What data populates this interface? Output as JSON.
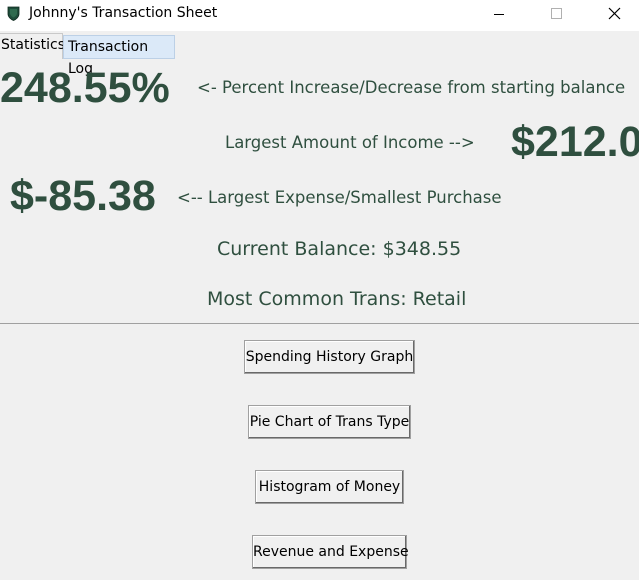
{
  "window": {
    "title": "Johnny's Transaction Sheet",
    "icon": "app-shield-icon",
    "controls": [
      "minimize-icon",
      "maximize-icon",
      "close-icon"
    ]
  },
  "tabs": [
    {
      "label": "Statistics",
      "active": true
    },
    {
      "label": "Transaction Log",
      "active": false
    }
  ],
  "stats": {
    "percent_value": "248.55%",
    "percent_label": "<- Percent Increase/Decrease from starting balance",
    "income_label": "Largest Amount of Income -->",
    "income_value": "$212.0",
    "expense_value": "$-85.38",
    "expense_label": "<-- Largest Expense/Smallest Purchase",
    "balance_text": "Current Balance: $348.55",
    "common_text": "Most Common Trans: Retail"
  },
  "buttons": {
    "spending": "Spending History Graph",
    "pie": "Pie Chart of Trans Type",
    "histogram": "Histogram of Money",
    "revenue": "Revenue and Expense"
  },
  "colors": {
    "stat_text": "#2f4f3f",
    "background": "#f0f0f0",
    "inactive_tab": "#dbe9f8"
  }
}
